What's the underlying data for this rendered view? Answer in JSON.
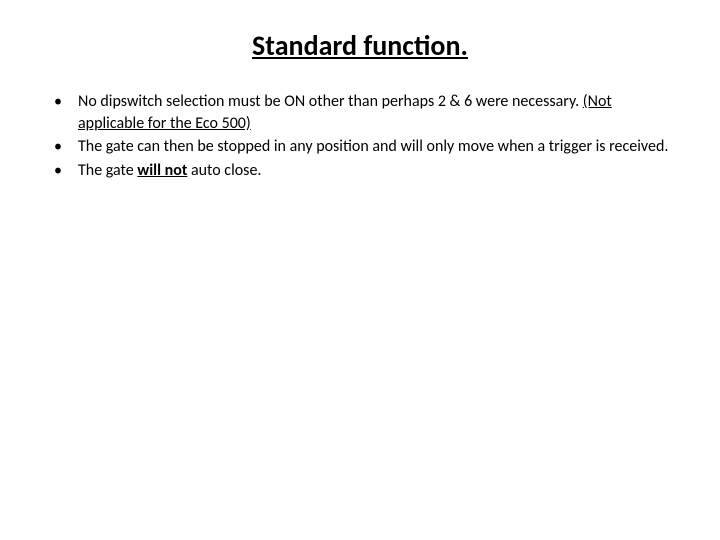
{
  "title": "Standard function.",
  "bullets": [
    {
      "prefix": "No dipswitch selection must be ON other than perhaps 2 & 6 were necessary. ",
      "underlined": "(Not applicable for the Eco 500)",
      "suffix": ""
    },
    {
      "prefix": "The gate can then be stopped in any position and will only move when a trigger is received.",
      "underlined": "",
      "suffix": ""
    },
    {
      "prefix": "The gate ",
      "underlined": "will not",
      "underlined_bold": true,
      "suffix": " auto close."
    }
  ]
}
